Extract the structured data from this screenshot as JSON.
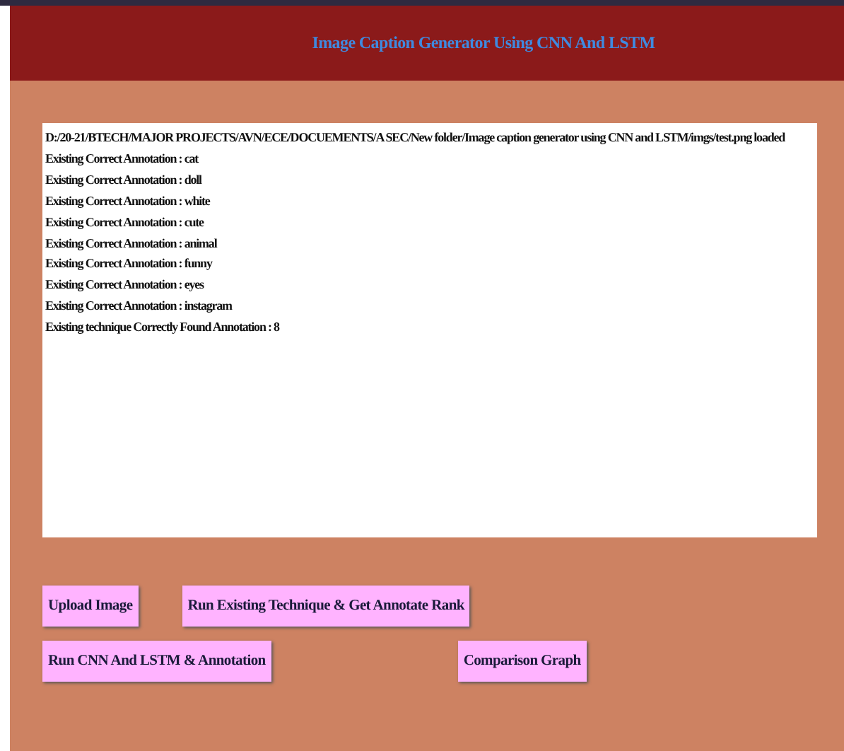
{
  "window": {
    "title": "Image Caption Generator Using CNN And LSTM"
  },
  "output": {
    "lines": [
      "D:/20-21/BTECH/MAJOR PROJECTS/AVN/ECE/DOCUEMENTS/A SEC/New folder/Image caption generator using CNN and LSTM/imgs/test.png loaded",
      "Existing Correct Annotation : cat",
      "Existing Correct Annotation : doll",
      "Existing Correct Annotation : white",
      "Existing Correct Annotation : cute",
      "Existing Correct Annotation : animal",
      "Existing Correct Annotation : funny",
      "Existing Correct Annotation : eyes",
      "Existing Correct Annotation : instagram",
      "Existing technique Correctly Found Annotation : 8"
    ]
  },
  "button_rows": [
    [
      "Upload Image",
      "Run Existing Technique & Get Annotate Rank"
    ],
    [
      "Run CNN And LSTM & Annotation",
      "Comparison Graph"
    ]
  ]
}
